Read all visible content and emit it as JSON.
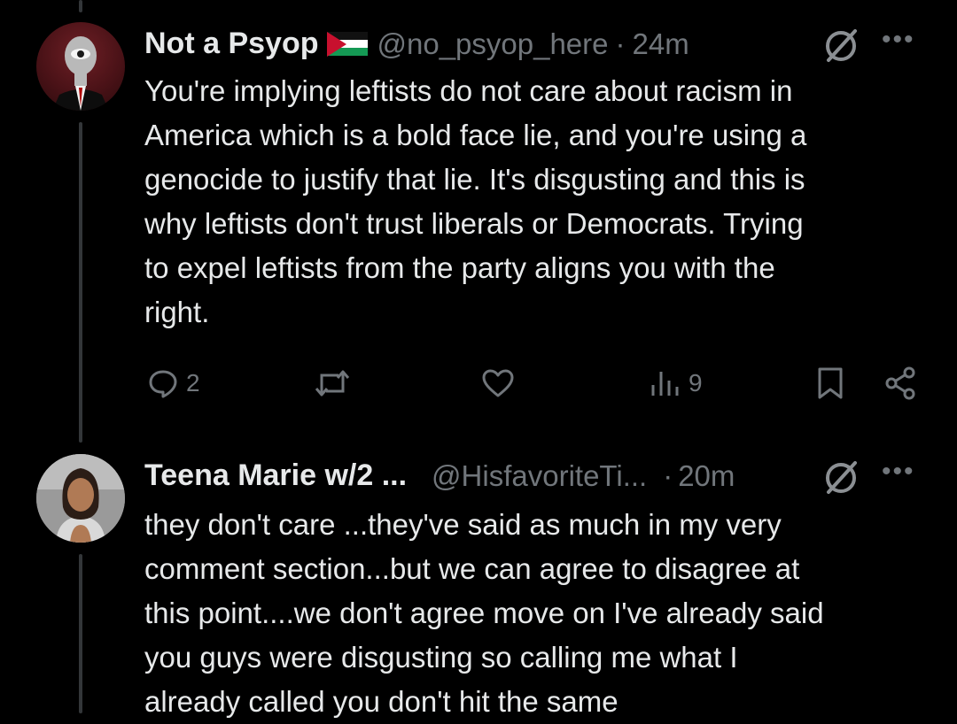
{
  "tweets": [
    {
      "display_name": "Not a Psyop",
      "flag": "palestine-flag",
      "handle": "@no_psyop_here",
      "separator": "·",
      "time": "24m",
      "text": "You're implying leftists do not care about racism in\nAmerica which is a bold face lie, and you're using a\ngenocide to justify that lie. It's disgusting and this is\nwhy leftists don't trust liberals or Democrats. Trying\nto expel leftists from the party aligns you with the\nright.",
      "replies": "2",
      "views": "9",
      "icons": [
        "no-symbol-icon",
        "more-icon",
        "reply-icon",
        "retweet-icon",
        "like-icon",
        "views-icon",
        "bookmark-icon",
        "share-icon"
      ]
    },
    {
      "display_name": "Teena Marie w/2 ...",
      "handle": "@HisfavoriteTi...",
      "separator": "·",
      "time": "20m",
      "text": "they don't care ...they've said as much in my very\ncomment section...but we can agree to disagree at\nthis point....we don't agree move on I've already said\nyou guys were disgusting so calling me what I\nalready called you don't hit the same"
    }
  ],
  "colors": {
    "background": "#000000",
    "text": "#e7e9ea",
    "muted": "#71767b",
    "thread_line": "#333639"
  }
}
